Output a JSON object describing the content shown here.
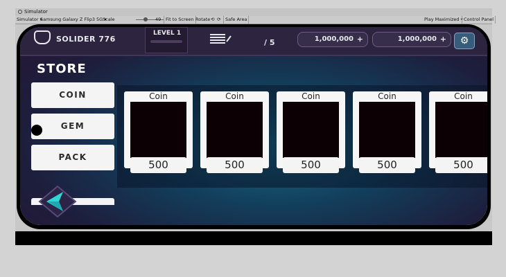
{
  "window": {
    "title": "Simulator"
  },
  "toolbar": {
    "mode": "Simulator",
    "device": "Samsung Galaxy Z Flip3 5G",
    "scale_label": "Scale",
    "scale_value": "49",
    "fit_label": "Fit to Screen",
    "rotate_label": "Rotate",
    "safe_area_label": "Safe Area",
    "play_mode": "Play Maximized",
    "control_panel": "Control Panel"
  },
  "hud": {
    "player_name": "SOLIDER 776",
    "level": "LEVEL 1",
    "count": "/ 5",
    "resource1": "1,000,000",
    "resource2": "1,000,000",
    "plus": "+",
    "settings_icon": "gear-icon"
  },
  "store": {
    "title": "STORE",
    "tabs": [
      {
        "label": "COIN"
      },
      {
        "label": "GEM"
      },
      {
        "label": "PACK"
      }
    ],
    "items": [
      {
        "name": "Coin",
        "price": "500"
      },
      {
        "name": "Coin",
        "price": "500"
      },
      {
        "name": "Coin",
        "price": "500"
      },
      {
        "name": "Coin",
        "price": "500"
      },
      {
        "name": "Coin",
        "price": "500"
      }
    ]
  },
  "colors": {
    "accent": "#2fd6d6",
    "background": "#1d1e3c",
    "card": "#f6f6f6"
  }
}
